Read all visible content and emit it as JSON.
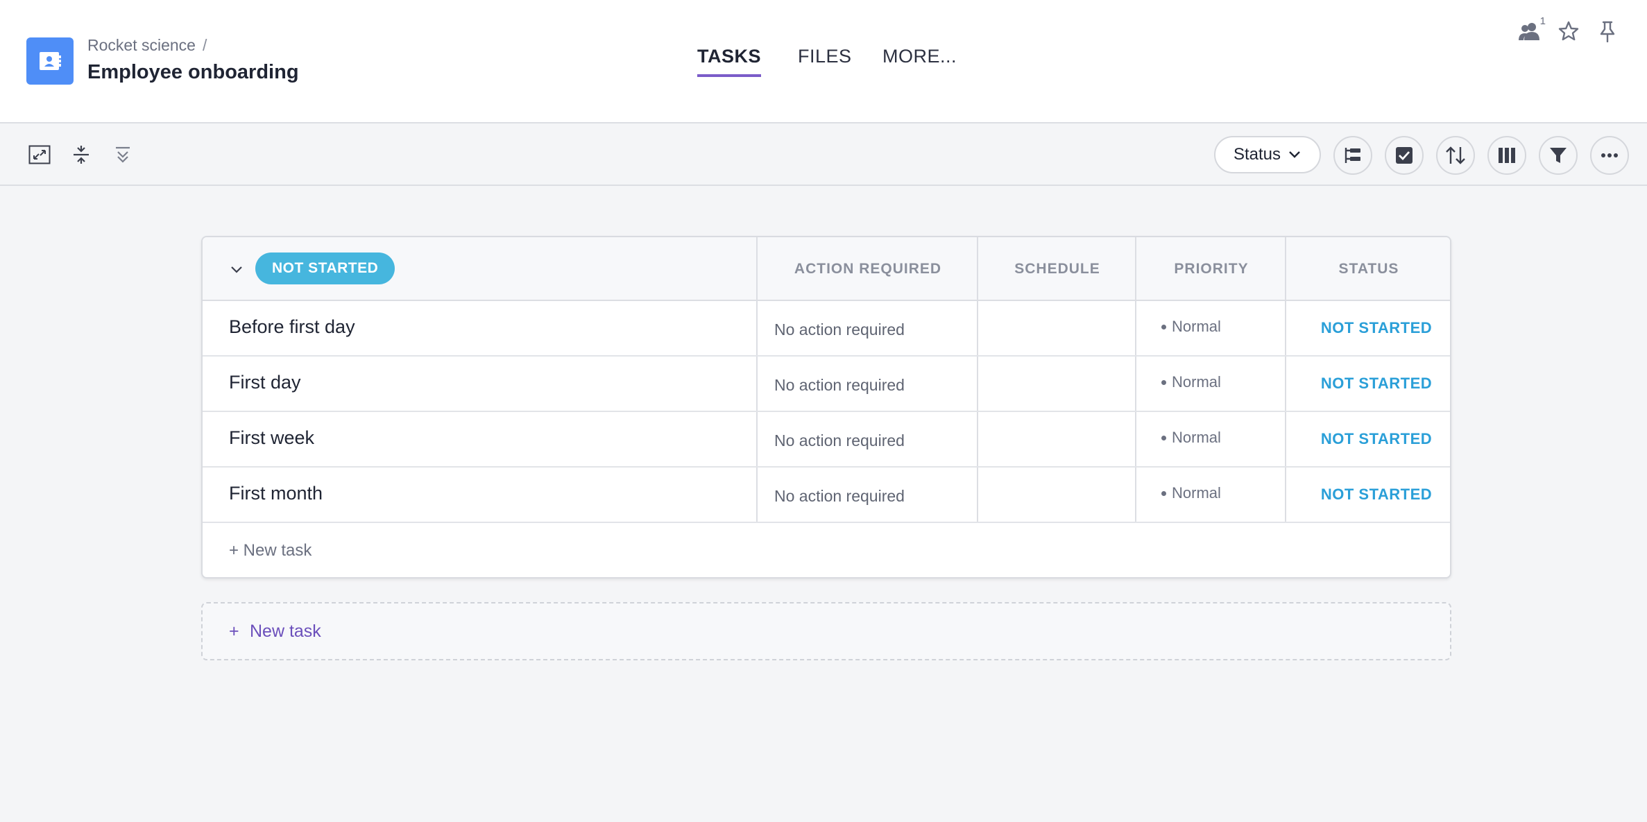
{
  "header": {
    "breadcrumb": "Rocket science",
    "breadcrumb_sep": "/",
    "title": "Employee onboarding",
    "tabs": [
      {
        "label": "TASKS",
        "active": true
      },
      {
        "label": "FILES",
        "active": false
      },
      {
        "label": "MORE..."
      }
    ],
    "members_count": "1",
    "icons": [
      "project-contact-icon",
      "members-icon",
      "star-icon",
      "pin-icon"
    ]
  },
  "toolbar": {
    "group_by_label": "Status",
    "left_icons": [
      "fullscreen-icon",
      "collapse-rows-icon",
      "collapse-groups-icon"
    ],
    "right_icons": [
      "hierarchy-icon",
      "checkbox-icon",
      "sort-icon",
      "columns-icon",
      "filter-icon",
      "more-icon"
    ]
  },
  "table": {
    "group_label": "NOT STARTED",
    "columns": [
      "ACTION REQUIRED",
      "SCHEDULE",
      "PRIORITY",
      "STATUS"
    ],
    "rows": [
      {
        "name": "Before first day",
        "action": "No action required",
        "schedule": "",
        "priority": "Normal",
        "status": "NOT STARTED"
      },
      {
        "name": "First day",
        "action": "No action required",
        "schedule": "",
        "priority": "Normal",
        "status": "NOT STARTED"
      },
      {
        "name": "First week",
        "action": "No action required",
        "schedule": "",
        "priority": "Normal",
        "status": "NOT STARTED"
      },
      {
        "name": "First month",
        "action": "No action required",
        "schedule": "",
        "priority": "Normal",
        "status": "NOT STARTED"
      }
    ],
    "new_task_inline": "+ New task"
  },
  "new_task_group": {
    "plus": "+",
    "label": "New task"
  },
  "colors": {
    "accent_purple": "#7b5cc9",
    "badge_blue": "#46b6de",
    "status_blue": "#2a9fd8",
    "project_icon_blue": "#4f8ef7"
  }
}
